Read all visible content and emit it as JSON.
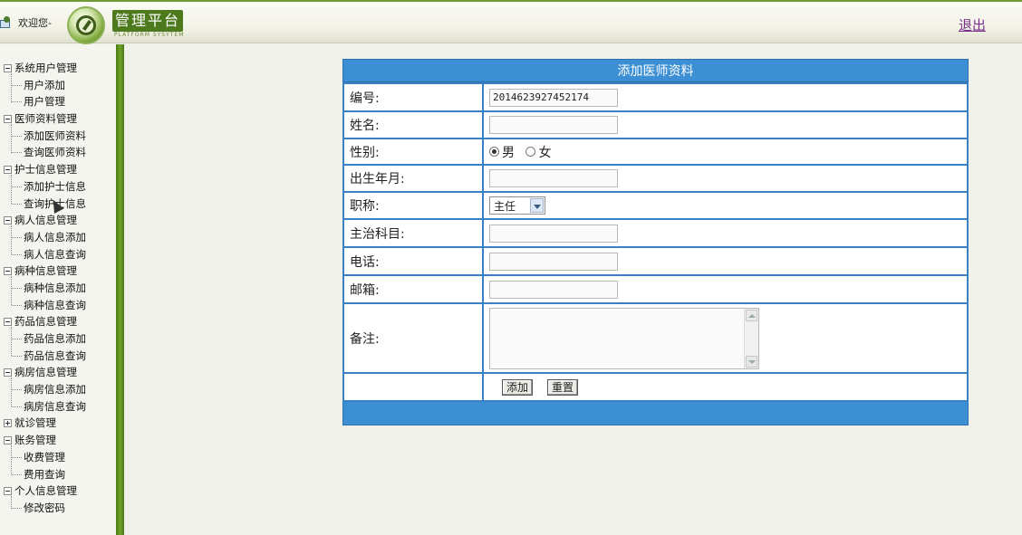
{
  "header": {
    "welcome": "欢迎您-",
    "brand_title": "管理平台",
    "brand_subtitle": "PLATFORM SYSYTEM",
    "logout": "退出"
  },
  "sidebar": {
    "groups": [
      {
        "label": "系统用户管理",
        "expanded": true,
        "items": [
          "用户添加",
          "用户管理"
        ]
      },
      {
        "label": "医师资料管理",
        "expanded": true,
        "items": [
          "添加医师资料",
          "查询医师资料"
        ]
      },
      {
        "label": "护士信息管理",
        "expanded": true,
        "items": [
          "添加护士信息",
          "查询护士信息"
        ]
      },
      {
        "label": "病人信息管理",
        "expanded": true,
        "items": [
          "病人信息添加",
          "病人信息查询"
        ]
      },
      {
        "label": "病种信息管理",
        "expanded": true,
        "items": [
          "病种信息添加",
          "病种信息查询"
        ]
      },
      {
        "label": "药品信息管理",
        "expanded": true,
        "items": [
          "药品信息添加",
          "药品信息查询"
        ]
      },
      {
        "label": "病房信息管理",
        "expanded": true,
        "items": [
          "病房信息添加",
          "病房信息查询"
        ]
      },
      {
        "label": "就诊管理",
        "expanded": false,
        "items": []
      },
      {
        "label": "账务管理",
        "expanded": true,
        "items": [
          "收费管理",
          "费用查询"
        ]
      },
      {
        "label": "个人信息管理",
        "expanded": true,
        "items": [
          "修改密码"
        ]
      }
    ]
  },
  "form": {
    "title": "添加医师资料",
    "fields": {
      "id": {
        "label": "编号:",
        "value": "2014623927452174"
      },
      "name": {
        "label": "姓名:",
        "value": ""
      },
      "gender": {
        "label": "性别:",
        "options": [
          "男",
          "女"
        ],
        "selected": "男"
      },
      "birth": {
        "label": "出生年月:",
        "value": ""
      },
      "title": {
        "label": "职称:",
        "value": "主任"
      },
      "department": {
        "label": "主治科目:",
        "value": ""
      },
      "phone": {
        "label": "电话:",
        "value": ""
      },
      "email": {
        "label": "邮箱:",
        "value": ""
      },
      "remark": {
        "label": "备注:",
        "value": ""
      }
    },
    "buttons": {
      "add": "添加",
      "reset": "重置"
    }
  }
}
